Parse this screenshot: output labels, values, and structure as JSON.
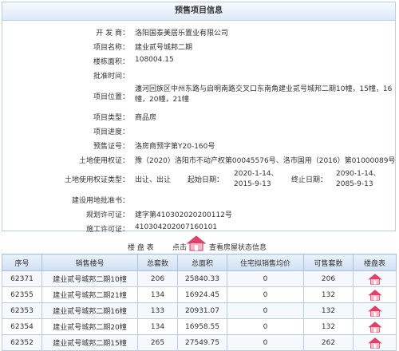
{
  "info": {
    "title": "预售项目信息",
    "developer_label": "开 发 商：",
    "developer": "洛阳国泰美居乐置业有限公司",
    "project_name_label": "项目名称：",
    "project_name": "建业贰号城邦二期",
    "building_area_label": "楼栋面积：",
    "building_area": "108004.15",
    "approval_time_label": "批准时间：",
    "approval_time": "",
    "location_label": "项目位置：",
    "location": "瀍河回族区中州东路与启明南路交叉口东南角建业贰号城邦二期10幢，15幢，16幢，20幢，21幢",
    "type_label": "项目类型：",
    "type": "商品房",
    "progress_label": "项目进度：",
    "progress": "",
    "presale_label": "预售证号：",
    "presale": "洛房商预字第Y20-160号",
    "land_cert_label": "土地使用权证：",
    "land_cert": "豫（2020）洛阳市不动产权第00045576号、洛市国用（2016）第01000089号",
    "land_type_label": "土地使用权证类型：",
    "land_type": "出让、出让",
    "start_date_label": "起始日期：",
    "start_date": "2020-1-14、2015-9-13",
    "end_date_label": "终止日期：",
    "end_date": "2090-1-14、2085-9-13",
    "land_approval_label": "建设用地批准书：",
    "land_approval": "",
    "planning_label": "规划许可证：",
    "planning": "建字第410302020200112号",
    "construction_label": "施工许可证：",
    "construction": "410304202007160101"
  },
  "legend": {
    "table_label": "楼 盘 表",
    "click_label": "点击",
    "view_label": "查看房屋状态信息"
  },
  "table": {
    "headers": [
      "序号",
      "销售楼号",
      "总套数",
      "总面积",
      "住宅拟销售均价",
      "可售套数",
      "楼盘表"
    ],
    "rows": [
      [
        "62371",
        "建业贰号城邦二期10幢",
        "206",
        "25840.33",
        "0",
        "206"
      ],
      [
        "62355",
        "建业贰号城邦二期21幢",
        "134",
        "16924.45",
        "0",
        "132"
      ],
      [
        "62353",
        "建业贰号城邦二期16幢",
        "133",
        "20931.07",
        "0",
        "132"
      ],
      [
        "62354",
        "建业贰号城邦二期20幢",
        "134",
        "16958.55",
        "0",
        "132"
      ],
      [
        "62352",
        "建业贰号城邦二期15幢",
        "265",
        "27549.75",
        "0",
        "262"
      ]
    ]
  },
  "colors": {
    "house_roof": "#e0406a",
    "house_body": "#f2b8c6",
    "header_border": "#a9c1e0"
  }
}
